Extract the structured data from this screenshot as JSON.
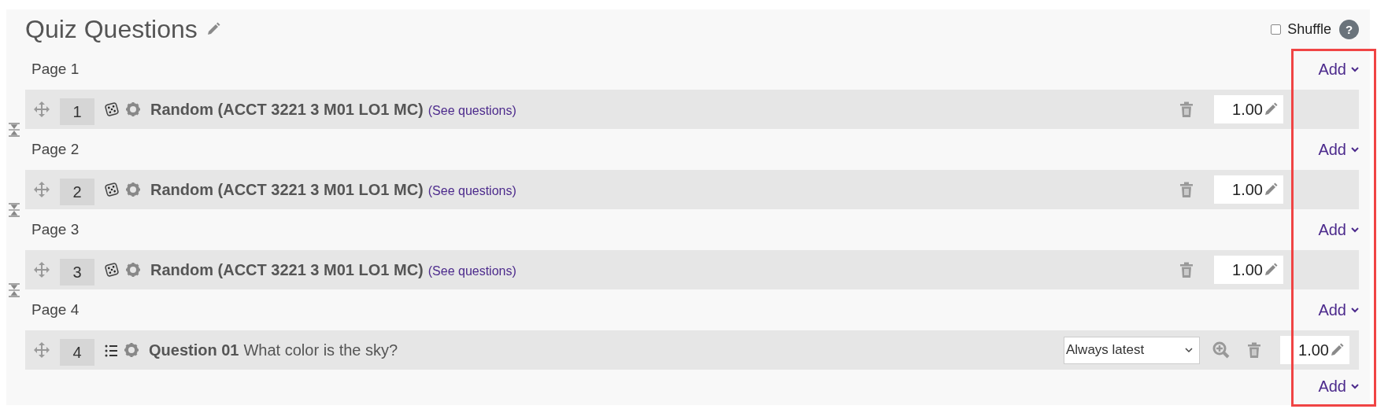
{
  "title": "Quiz Questions",
  "shuffle": {
    "label": "Shuffle",
    "checked": false
  },
  "help": "?",
  "pages": [
    {
      "label": "Page 1",
      "add": "Add",
      "slots": [
        {
          "kind": "random",
          "number": "1",
          "title": "Random (ACCT 3221 3 M01 LO1 MC)",
          "link": "(See questions)",
          "mark": "1.00",
          "page_break_toggle": true
        }
      ]
    },
    {
      "label": "Page 2",
      "add": "Add",
      "slots": [
        {
          "kind": "random",
          "number": "2",
          "title": "Random (ACCT 3221 3 M01 LO1 MC)",
          "link": "(See questions)",
          "mark": "1.00",
          "page_break_toggle": true
        }
      ]
    },
    {
      "label": "Page 3",
      "add": "Add",
      "slots": [
        {
          "kind": "random",
          "number": "3",
          "title": "Random (ACCT 3221 3 M01 LO1 MC)",
          "link": "(See questions)",
          "mark": "1.00",
          "page_break_toggle": true
        }
      ]
    },
    {
      "label": "Page 4",
      "add": "Add",
      "slots": [
        {
          "kind": "question",
          "number": "4",
          "name": "Question 01",
          "text": "What color is the sky?",
          "version": "Always latest",
          "mark": "1.00",
          "page_break_toggle": false
        }
      ]
    }
  ],
  "final_add": "Add",
  "highlight_add_column": true
}
